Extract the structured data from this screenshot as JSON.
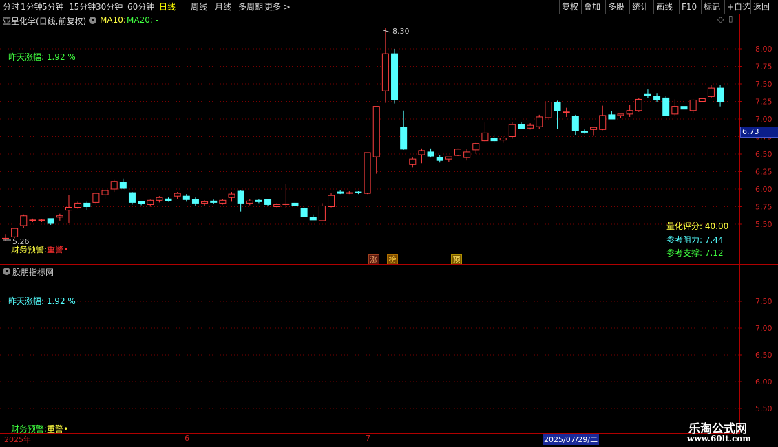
{
  "toolbar": {
    "left_items": [
      "分时",
      "1分钟",
      "5分钟",
      "15分钟",
      "30分钟",
      "60分钟",
      "日线",
      "周线",
      "月线",
      "多周期",
      "更多 >"
    ],
    "active": "日线",
    "right_items": [
      "复权",
      "叠加",
      "多股",
      "统计",
      "画线",
      "F10",
      "标记",
      "+自选",
      "返回"
    ]
  },
  "main_header": {
    "stock": "亚星化学(日线,前复权)",
    "ma10": "MA10:",
    "ma20": "MA20: -"
  },
  "main_panel": {
    "yesterday_label": "昨天涨幅: ",
    "yesterday_value": "1.92 %",
    "high_label": "8.30",
    "low_label": "5.26",
    "finance_warn": "财务预警:",
    "finance_red": "重警",
    "quant_score_label": "量化评分: ",
    "quant_score_value": "40.00",
    "resistance_label": "参考阻力: ",
    "resistance_value": "7.44",
    "support_label": "参考支撑: ",
    "support_value": "7.12",
    "current_price": "6.73",
    "tags": [
      "涨",
      "榜",
      "预"
    ],
    "y_ticks": [
      "8.00",
      "7.75",
      "7.50",
      "7.25",
      "7.00",
      "6.75",
      "6.50",
      "6.25",
      "6.00",
      "5.75",
      "5.50"
    ]
  },
  "sub_panel": {
    "title": "股朋指标网",
    "yesterday_label": "昨天涨幅: ",
    "yesterday_value": "1.92 %",
    "finance_warn": "财务预警:",
    "finance_yellow": "重警",
    "y_ticks": [
      "7.50",
      "7.00",
      "6.50",
      "6.00",
      "5.50"
    ]
  },
  "date_axis": {
    "labels": [
      "2025年",
      "6",
      "7"
    ],
    "selected": "2025/07/29/二"
  },
  "watermark": {
    "line1": "乐淘公式网",
    "line2": "www.60lt.com"
  },
  "colors": {
    "up": "#ff4040",
    "down": "#54ffff",
    "grid": "#7a0000",
    "axis": "#b00000"
  },
  "chart_data": {
    "type": "candlestick",
    "ohlc": [
      [
        5.3,
        5.36,
        5.26,
        5.3
      ],
      [
        5.32,
        5.45,
        5.3,
        5.44
      ],
      [
        5.48,
        5.64,
        5.45,
        5.62
      ],
      [
        5.56,
        5.58,
        5.53,
        5.56
      ],
      [
        5.55,
        5.57,
        5.53,
        5.56
      ],
      [
        5.58,
        5.56,
        5.49,
        5.51
      ],
      [
        5.6,
        5.65,
        5.55,
        5.62
      ],
      [
        5.7,
        5.92,
        5.52,
        5.74
      ],
      [
        5.74,
        5.82,
        5.72,
        5.8
      ],
      [
        5.8,
        5.82,
        5.7,
        5.75
      ],
      [
        5.81,
        5.95,
        5.78,
        5.94
      ],
      [
        5.92,
        6.0,
        5.86,
        5.98
      ],
      [
        6.0,
        6.13,
        5.96,
        6.11
      ],
      [
        6.1,
        6.15,
        6.0,
        6.01
      ],
      [
        5.95,
        5.96,
        5.78,
        5.81
      ],
      [
        5.82,
        5.83,
        5.77,
        5.79
      ],
      [
        5.78,
        5.85,
        5.75,
        5.84
      ],
      [
        5.84,
        5.9,
        5.81,
        5.88
      ],
      [
        5.86,
        5.88,
        5.82,
        5.83
      ],
      [
        5.9,
        5.96,
        5.86,
        5.94
      ],
      [
        5.9,
        5.93,
        5.82,
        5.85
      ],
      [
        5.85,
        5.88,
        5.76,
        5.8
      ],
      [
        5.8,
        5.84,
        5.76,
        5.82
      ],
      [
        5.83,
        5.85,
        5.79,
        5.81
      ],
      [
        5.8,
        5.86,
        5.78,
        5.84
      ],
      [
        5.88,
        5.96,
        5.82,
        5.93
      ],
      [
        5.97,
        5.98,
        5.68,
        5.8
      ],
      [
        5.8,
        5.86,
        5.77,
        5.83
      ],
      [
        5.84,
        5.86,
        5.8,
        5.82
      ],
      [
        5.85,
        5.86,
        5.76,
        5.78
      ],
      [
        5.75,
        5.8,
        5.74,
        5.78
      ],
      [
        5.79,
        6.07,
        5.73,
        5.79
      ],
      [
        5.8,
        5.83,
        5.74,
        5.76
      ],
      [
        5.73,
        5.74,
        5.6,
        5.61
      ],
      [
        5.6,
        5.64,
        5.56,
        5.56
      ],
      [
        5.55,
        5.8,
        5.54,
        5.76
      ],
      [
        5.75,
        5.94,
        5.74,
        5.91
      ],
      [
        5.96,
        5.99,
        5.93,
        5.94
      ],
      [
        5.95,
        5.97,
        5.93,
        5.95
      ],
      [
        5.96,
        5.97,
        5.93,
        5.95
      ],
      [
        5.94,
        6.52,
        5.93,
        6.52
      ],
      [
        6.46,
        7.18,
        6.22,
        7.18
      ],
      [
        7.4,
        8.3,
        7.23,
        7.93
      ],
      [
        7.93,
        8.0,
        7.22,
        7.27
      ],
      [
        6.88,
        7.12,
        6.56,
        6.57
      ],
      [
        6.35,
        6.45,
        6.31,
        6.43
      ],
      [
        6.49,
        6.58,
        6.37,
        6.55
      ],
      [
        6.53,
        6.58,
        6.45,
        6.47
      ],
      [
        6.45,
        6.48,
        6.38,
        6.41
      ],
      [
        6.43,
        6.46,
        6.39,
        6.46
      ],
      [
        6.48,
        6.58,
        6.47,
        6.57
      ],
      [
        6.45,
        6.57,
        6.41,
        6.53
      ],
      [
        6.56,
        6.66,
        6.5,
        6.65
      ],
      [
        6.69,
        6.95,
        6.67,
        6.8
      ],
      [
        6.73,
        6.78,
        6.66,
        6.69
      ],
      [
        6.7,
        6.75,
        6.66,
        6.73
      ],
      [
        6.75,
        6.95,
        6.72,
        6.92
      ],
      [
        6.92,
        6.95,
        6.86,
        6.86
      ],
      [
        6.87,
        6.94,
        6.85,
        6.91
      ],
      [
        6.89,
        7.06,
        6.86,
        7.03
      ],
      [
        7.02,
        7.25,
        7.01,
        7.24
      ],
      [
        7.24,
        7.26,
        6.86,
        7.12
      ],
      [
        7.09,
        7.16,
        7.03,
        7.1
      ],
      [
        7.04,
        7.06,
        6.77,
        6.83
      ],
      [
        6.82,
        6.85,
        6.79,
        6.81
      ],
      [
        6.85,
        6.88,
        6.76,
        6.88
      ],
      [
        6.85,
        7.19,
        6.84,
        7.05
      ],
      [
        7.06,
        7.11,
        7.0,
        7.0
      ],
      [
        7.05,
        7.07,
        7.02,
        7.07
      ],
      [
        7.07,
        7.2,
        7.03,
        7.12
      ],
      [
        7.12,
        7.3,
        7.1,
        7.28
      ],
      [
        7.36,
        7.42,
        7.3,
        7.33
      ],
      [
        7.32,
        7.37,
        7.24,
        7.27
      ],
      [
        7.3,
        7.33,
        7.05,
        7.05
      ],
      [
        7.07,
        7.28,
        7.05,
        7.18
      ],
      [
        7.18,
        7.24,
        7.12,
        7.14
      ],
      [
        7.12,
        7.28,
        7.08,
        7.27
      ],
      [
        7.25,
        7.3,
        7.25,
        7.29
      ],
      [
        7.32,
        7.48,
        7.3,
        7.44
      ],
      [
        7.44,
        7.49,
        7.18,
        7.24
      ]
    ]
  }
}
